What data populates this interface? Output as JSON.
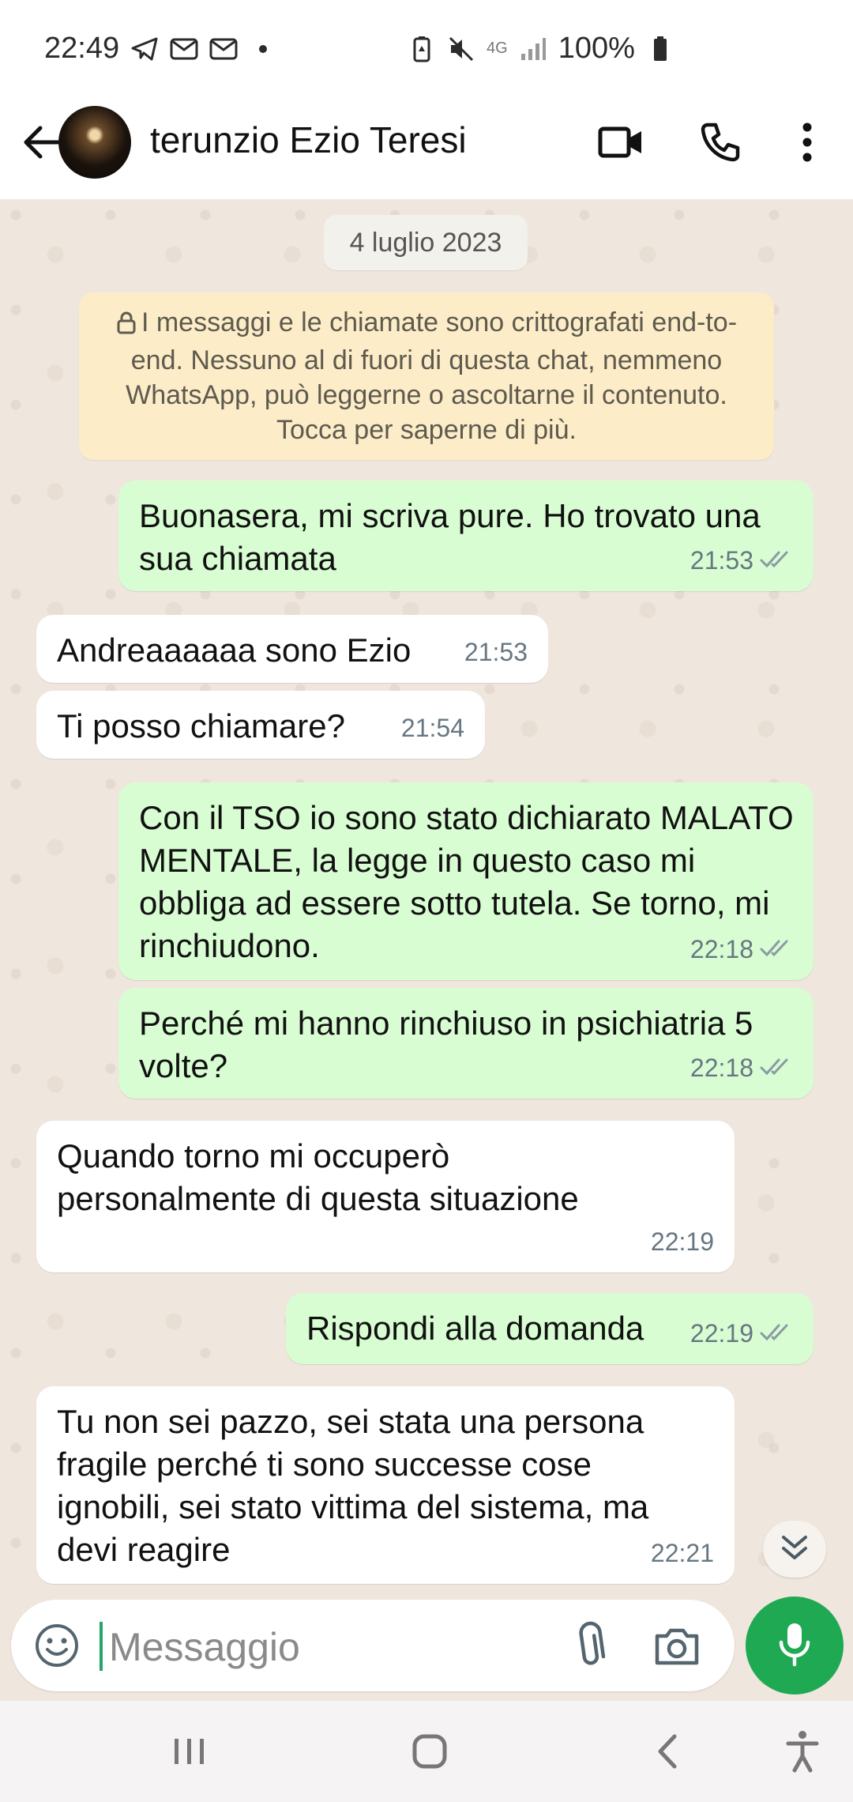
{
  "status_bar": {
    "time": "22:49",
    "battery": "100%",
    "network": "4G",
    "icons": [
      "telegram-icon",
      "mail-icon",
      "mail-icon",
      "dot-icon",
      "battery-saver-icon",
      "mute-icon",
      "network-4g-icon",
      "signal-icon",
      "battery-icon"
    ]
  },
  "header": {
    "contact_name": "terunzio Ezio Teresi",
    "icons": [
      "back-arrow-icon",
      "video-call-icon",
      "phone-icon",
      "more-vertical-icon"
    ]
  },
  "chat": {
    "date": "4 luglio 2023",
    "encryption_notice": "I messaggi e le chiamate sono crittografati end-to-end. Nessuno al di fuori di questa chat, nemmeno WhatsApp, può leggerne o ascoltarne il contenuto. Tocca per saperne di più.",
    "messages": [
      {
        "dir": "out",
        "text": "Buonasera, mi scriva pure. Ho trovato una sua chiamata",
        "time": "21:53",
        "status": "read"
      },
      {
        "dir": "in",
        "text": "Andreaaaaaa sono Ezio",
        "time": "21:53"
      },
      {
        "dir": "in",
        "text": "Ti posso chiamare?",
        "time": "21:54"
      },
      {
        "dir": "out",
        "text": "Con il TSO io sono stato dichiarato MALATO MENTALE, la legge in questo caso mi obbliga ad essere sotto tutela. Se torno, mi rinchiudono.",
        "time": "22:18",
        "status": "read"
      },
      {
        "dir": "out",
        "text": "Perché mi hanno rinchiuso in psichiatria 5 volte?",
        "time": "22:18",
        "status": "read"
      },
      {
        "dir": "in",
        "text": "Quando torno mi occuperò personalmente di questa situazione",
        "time": "22:19"
      },
      {
        "dir": "out",
        "text": "Rispondi alla domanda",
        "time": "22:19",
        "status": "read"
      },
      {
        "dir": "in",
        "text": "Tu non sei pazzo, sei stata una persona fragile perché ti sono successe cose ignobili, sei stato vittima del sistema, ma devi reagire",
        "time": "22:21"
      }
    ]
  },
  "composer": {
    "placeholder": "Messaggio",
    "icons": [
      "emoji-icon",
      "attach-icon",
      "camera-icon",
      "mic-icon"
    ]
  },
  "colors": {
    "outgoing_bubble": "#d9fdd3",
    "incoming_bubble": "#ffffff",
    "chat_background": "#efe7de",
    "notice_background": "#fdecc8",
    "accent_green": "#1ea952",
    "read_ticks": "#8a9aa3"
  },
  "nav_bar": {
    "icons": [
      "recent-apps-icon",
      "home-icon",
      "back-icon",
      "accessibility-icon"
    ]
  }
}
